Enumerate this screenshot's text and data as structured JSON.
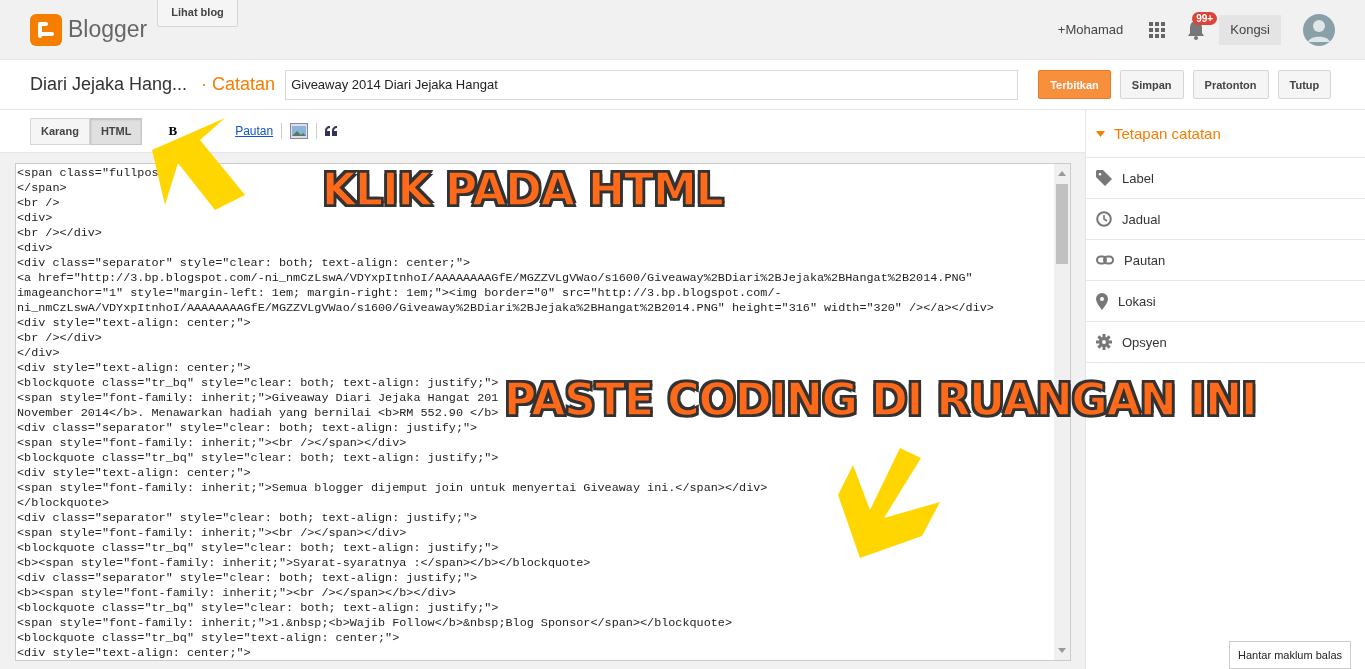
{
  "header": {
    "brand": "Blogger",
    "view_blog": "Lihat blog",
    "user": "+Mohamad",
    "notification_badge": "99+",
    "share": "Kongsi"
  },
  "post_bar": {
    "blog_title": "Diari Jejaka Hang...",
    "section": "· Catatan",
    "post_title": "Giveaway 2014 Diari Jejaka Hangat",
    "buttons": [
      {
        "label": "Terbitkan",
        "primary": true
      },
      {
        "label": "Simpan",
        "primary": false
      },
      {
        "label": "Pratonton",
        "primary": false
      },
      {
        "label": "Tutup",
        "primary": false
      }
    ]
  },
  "modes": [
    {
      "label": "Karang",
      "selected": false
    },
    {
      "label": "HTML",
      "selected": true
    }
  ],
  "toolbar": [
    {
      "kind": "bold",
      "text": "B"
    },
    {
      "kind": "link",
      "text": "Pautan"
    },
    {
      "kind": "image"
    },
    {
      "kind": "quote"
    }
  ],
  "code_lines": [
    "<span class=\"fullpos",
    "</span>",
    "<br />",
    "<div>",
    "<br /></div>",
    "<div>",
    "<div class=\"separator\" style=\"clear: both; text-align: center;\">",
    "<a href=\"http://3.bp.blogspot.com/-ni_nmCzLswA/VDYxpItnhoI/AAAAAAAAGfE/MGZZVLgVWao/s1600/Giveaway%2BDiari%2BJejaka%2BHangat%2B2014.PNG\"",
    "imageanchor=\"1\" style=\"margin-left: 1em; margin-right: 1em;\"><img border=\"0\" src=\"http://3.bp.blogspot.com/-",
    "ni_nmCzLswA/VDYxpItnhoI/AAAAAAAAGfE/MGZZVLgVWao/s1600/Giveaway%2BDiari%2BJejaka%2BHangat%2B2014.PNG\" height=\"316\" width=\"320\" /></a></div>",
    "<div style=\"text-align: center;\">",
    "<br /></div>",
    "</div>",
    "<div style=\"text-align: center;\">",
    "<blockquote class=\"tr_bq\" style=\"clear: both; text-align: justify;\">",
    "<span style=\"font-family: inherit;\">Giveaway Diari Jejaka Hangat 201",
    "November 2014</b>. Menawarkan hadiah yang bernilai <b>RM 552.90 </b>",
    "<div class=\"separator\" style=\"clear: both; text-align: justify;\">",
    "<span style=\"font-family: inherit;\"><br /></span></div>",
    "<blockquote class=\"tr_bq\" style=\"clear: both; text-align: justify;\">",
    "<div style=\"text-align: center;\">",
    "<span style=\"font-family: inherit;\">Semua blogger dijemput join untuk menyertai Giveaway ini.</span></div>",
    "</blockquote>",
    "<div class=\"separator\" style=\"clear: both; text-align: justify;\">",
    "<span style=\"font-family: inherit;\"><br /></span></div>",
    "<blockquote class=\"tr_bq\" style=\"clear: both; text-align: justify;\">",
    "<b><span style=\"font-family: inherit;\">Syarat-syaratnya :</span></b></blockquote>",
    "<div class=\"separator\" style=\"clear: both; text-align: justify;\">",
    "<b><span style=\"font-family: inherit;\"><br /></span></b></div>",
    "<blockquote class=\"tr_bq\" style=\"clear: both; text-align: justify;\">",
    "<span style=\"font-family: inherit;\">1.&nbsp;<b>Wajib Follow</b>&nbsp;Blog Sponsor</span></blockquote>",
    "<blockquote class=\"tr_bq\" style=\"text-align: center;\">",
    "<div style=\"text-align: center;\">"
  ],
  "sidebar": {
    "title": "Tetapan catatan",
    "expanded": true,
    "items": [
      {
        "kind": "label",
        "label": "Label"
      },
      {
        "kind": "schedule",
        "label": "Jadual"
      },
      {
        "kind": "link",
        "label": "Pautan"
      },
      {
        "kind": "location",
        "label": "Lokasi"
      },
      {
        "kind": "options",
        "label": "Opsyen"
      }
    ]
  },
  "annotations": [
    "KLIK PADA HTML",
    "PASTE CODING DI RUANGAN INI"
  ],
  "feedback": "Hantar maklum balas"
}
